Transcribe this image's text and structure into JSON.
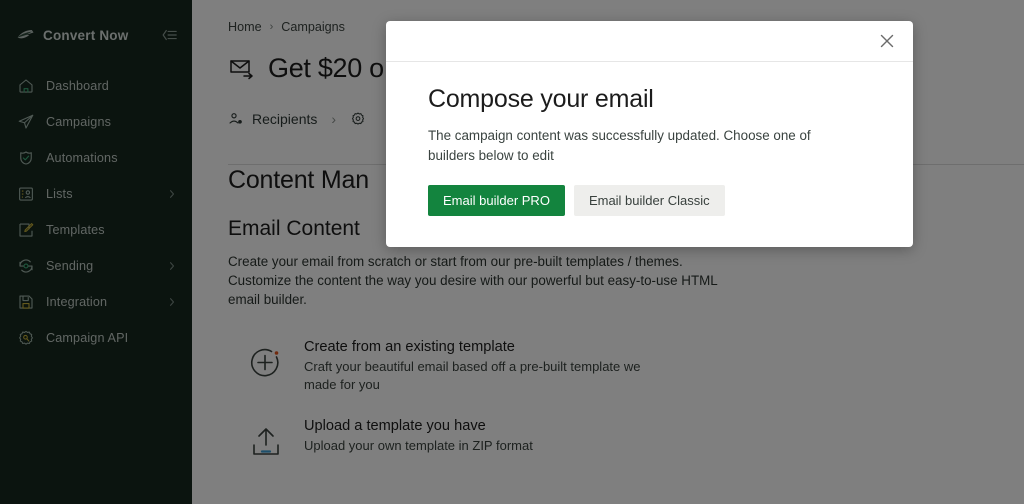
{
  "sidebar": {
    "brand": {
      "name": "Convert Now",
      "logo_icon": "leaf-logo-icon"
    },
    "collapse_icon": "collapse-menu-icon",
    "items": [
      {
        "label": "Dashboard",
        "icon": "home-icon",
        "has_chevron": false
      },
      {
        "label": "Campaigns",
        "icon": "paper-plane-icon",
        "has_chevron": false
      },
      {
        "label": "Automations",
        "icon": "shield-check-icon",
        "has_chevron": false
      },
      {
        "label": "Lists",
        "icon": "contact-list-icon",
        "has_chevron": true
      },
      {
        "label": "Templates",
        "icon": "edit-template-icon",
        "has_chevron": false
      },
      {
        "label": "Sending",
        "icon": "refresh-icon",
        "has_chevron": true
      },
      {
        "label": "Integration",
        "icon": "save-plug-icon",
        "has_chevron": true
      },
      {
        "label": "Campaign API",
        "icon": "gear-key-icon",
        "has_chevron": false
      }
    ]
  },
  "main": {
    "breadcrumb": {
      "home": "Home",
      "separator": "›",
      "current": "Campaigns"
    },
    "page_title": {
      "text": "Get $20 o",
      "icon": "envelope-send-icon"
    },
    "tabs": {
      "recipients_label": "Recipients",
      "recipients_icon": "recipients-icon",
      "separator": "›",
      "settings_icon": "gear-icon"
    },
    "section_title": "Content Man",
    "subsection_title": "Email Content",
    "body_copy": "Create your email from scratch or start from our pre-built templates / themes. Customize the content the way you desire with our powerful but easy-to-use HTML email builder.",
    "options": [
      {
        "icon": "plus-circle-icon",
        "title": "Create from an existing template",
        "desc": "Craft your beautiful email based off a pre-built template we made for you"
      },
      {
        "icon": "upload-icon",
        "title": "Upload a template you have",
        "desc": "Upload your own template in ZIP format"
      }
    ]
  },
  "modal": {
    "close_icon": "close-icon",
    "title": "Compose your email",
    "description": "The campaign content was successfully updated. Choose one of builders below to edit",
    "primary_button": "Email builder PRO",
    "secondary_button": "Email builder Classic"
  },
  "colors": {
    "sidebar_bg": "#16291f",
    "primary_green": "#13843e",
    "secondary_gray": "#eeeeec",
    "accent_orange": "#e2571e",
    "accent_blue": "#3d9fd6"
  }
}
